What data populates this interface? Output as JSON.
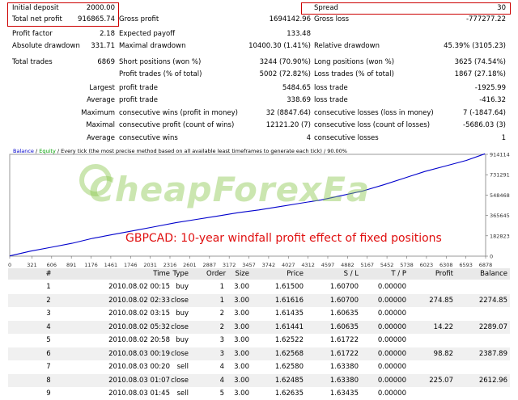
{
  "summary": {
    "initial_deposit_label": "Initial deposit",
    "initial_deposit_value": "2000.00",
    "total_net_profit_label": "Total net profit",
    "total_net_profit_value": "916865.74",
    "gross_profit_label": "Gross profit",
    "gross_profit_value": "1694142.96",
    "gross_loss_label": "Gross loss",
    "gross_loss_value": "-777277.22",
    "spread_label": "Spread",
    "spread_value": "30",
    "profit_factor_label": "Profit factor",
    "profit_factor_value": "2.18",
    "expected_payoff_label": "Expected payoff",
    "expected_payoff_value": "133.48",
    "absolute_drawdown_label": "Absolute drawdown",
    "absolute_drawdown_value": "331.71",
    "maximal_drawdown_label": "Maximal drawdown",
    "maximal_drawdown_value": "10400.30 (1.41%)",
    "relative_drawdown_label": "Relative drawdown",
    "relative_drawdown_value": "45.39% (3105.23)",
    "total_trades_label": "Total trades",
    "total_trades_value": "6869",
    "short_positions_label": "Short positions (won %)",
    "short_positions_value": "3244 (70.90%)",
    "long_positions_label": "Long positions (won %)",
    "long_positions_value": "3625 (74.54%)",
    "profit_trades_label": "Profit trades (% of total)",
    "profit_trades_value": "5002 (72.82%)",
    "loss_trades_label": "Loss trades (% of total)",
    "loss_trades_value": "1867 (27.18%)",
    "largest_label": "Largest",
    "largest_profit_label": "profit trade",
    "largest_profit_value": "5484.65",
    "largest_loss_label": "loss trade",
    "largest_loss_value": "-1925.99",
    "average_label": "Average",
    "average_profit_label": "profit trade",
    "average_profit_value": "338.69",
    "average_loss_label": "loss trade",
    "average_loss_value": "-416.32",
    "maximum_label": "Maximum",
    "max_cons_wins_label": "consecutive wins (profit in money)",
    "max_cons_wins_value": "32 (8847.64)",
    "max_cons_losses_label": "consecutive losses (loss in money)",
    "max_cons_losses_value": "7 (-1847.64)",
    "maximal_label": "Maximal",
    "maximal_cons_profit_label": "consecutive profit (count of wins)",
    "maximal_cons_profit_value": "12121.20 (7)",
    "maximal_cons_loss_label": "consecutive loss (count of losses)",
    "maximal_cons_loss_value": "-5686.03 (3)",
    "average2_label": "Average",
    "avg_cons_wins_label": "consecutive wins",
    "avg_cons_wins_value": "4",
    "avg_cons_losses_label": "consecutive losses",
    "avg_cons_losses_value": "1"
  },
  "watermark": "CheapForexEa",
  "caption": "GBPCAD: 10-year windfall profit effect of fixed positions",
  "chart_data": {
    "type": "line",
    "legend_text_balance": "Balance",
    "legend_sep": " / ",
    "legend_text_equity": "Equity",
    "legend_text_rest": " / Every tick (the most precise method based on all available least timeframes to generate each tick) / 90.00%",
    "x_ticks": [
      "0",
      "321",
      "606",
      "891",
      "1176",
      "1461",
      "1746",
      "2031",
      "2316",
      "2601",
      "2887",
      "3172",
      "3457",
      "3742",
      "4027",
      "4312",
      "4597",
      "4882",
      "5167",
      "5452",
      "5738",
      "6023",
      "6308",
      "6593",
      "6878"
    ],
    "y_ticks": [
      "914114",
      "731291",
      "548468",
      "365645",
      "182823",
      "0"
    ],
    "xlim": [
      0,
      6878
    ],
    "ylim": [
      0,
      914114
    ],
    "series": [
      {
        "color": "#0000cc",
        "x": [
          0,
          300,
          600,
          900,
          1200,
          1500,
          1800,
          2100,
          2400,
          2700,
          3000,
          3300,
          3600,
          3900,
          4200,
          4500,
          4800,
          5100,
          5400,
          5700,
          6000,
          6300,
          6600,
          6869
        ],
        "y": [
          2000,
          45000,
          80000,
          115000,
          160000,
          195000,
          230000,
          265000,
          300000,
          330000,
          360000,
          390000,
          415000,
          445000,
          475000,
          505000,
          545000,
          585000,
          640000,
          700000,
          760000,
          810000,
          860000,
          918865
        ]
      }
    ]
  },
  "table": {
    "columns": [
      "#",
      "Time",
      "Type",
      "Order",
      "Size",
      "Price",
      "S / L",
      "T / P",
      "Profit",
      "Balance"
    ],
    "rows": [
      [
        "1",
        "2010.08.02 00:15",
        "buy",
        "1",
        "3.00",
        "1.61500",
        "1.60700",
        "0.00000",
        "",
        ""
      ],
      [
        "2",
        "2010.08.02 02:33",
        "close",
        "1",
        "3.00",
        "1.61616",
        "1.60700",
        "0.00000",
        "274.85",
        "2274.85"
      ],
      [
        "3",
        "2010.08.02 03:15",
        "buy",
        "2",
        "3.00",
        "1.61435",
        "1.60635",
        "0.00000",
        "",
        ""
      ],
      [
        "4",
        "2010.08.02 05:32",
        "close",
        "2",
        "3.00",
        "1.61441",
        "1.60635",
        "0.00000",
        "14.22",
        "2289.07"
      ],
      [
        "5",
        "2010.08.02 20:58",
        "buy",
        "3",
        "3.00",
        "1.62522",
        "1.61722",
        "0.00000",
        "",
        ""
      ],
      [
        "6",
        "2010.08.03 00:19",
        "close",
        "3",
        "3.00",
        "1.62568",
        "1.61722",
        "0.00000",
        "98.82",
        "2387.89"
      ],
      [
        "7",
        "2010.08.03 00:20",
        "sell",
        "4",
        "3.00",
        "1.62580",
        "1.63380",
        "0.00000",
        "",
        ""
      ],
      [
        "8",
        "2010.08.03 01:07",
        "close",
        "4",
        "3.00",
        "1.62485",
        "1.63380",
        "0.00000",
        "225.07",
        "2612.96"
      ],
      [
        "9",
        "2010.08.03 01:45",
        "sell",
        "5",
        "3.00",
        "1.62635",
        "1.63435",
        "0.00000",
        "",
        ""
      ]
    ]
  }
}
